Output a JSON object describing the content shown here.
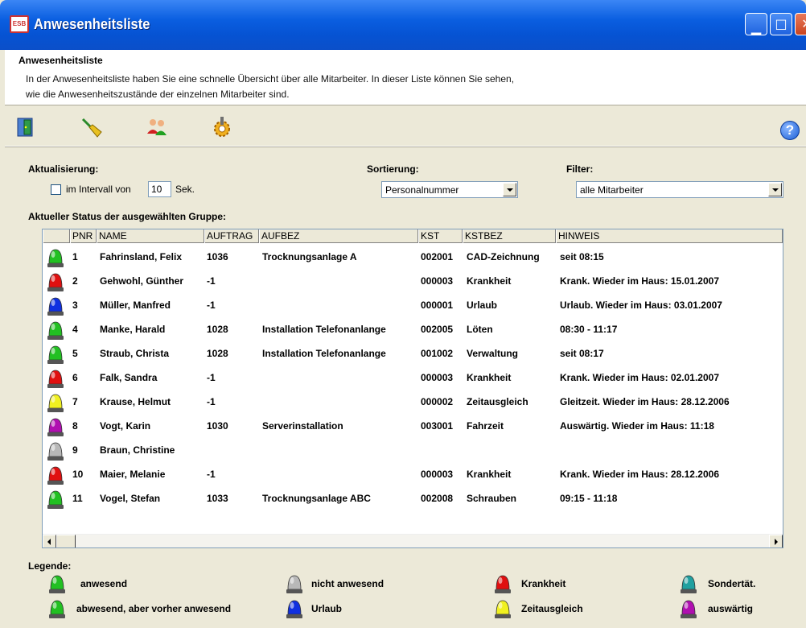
{
  "window": {
    "title": "Anwesenheitsliste",
    "app_icon_text": "ESB"
  },
  "header": {
    "title": "Anwesenheitsliste",
    "desc_line1": "In der Anwesenheitsliste haben Sie eine schnelle Übersicht über alle Mitarbeiter. In dieser Liste können Sie sehen,",
    "desc_line2": "wie die Anwesenheitszustände der einzelnen Mitarbeiter sind."
  },
  "toolbar": {
    "icons": [
      "exit-door-icon",
      "broom-icon",
      "users-icon",
      "settings-gear-icon"
    ],
    "help_label": "?"
  },
  "controls": {
    "aktualisierung_label": "Aktualisierung:",
    "interval_checkbox_label": "im Intervall von",
    "interval_value": "10",
    "interval_unit": "Sek.",
    "sortierung_label": "Sortierung:",
    "sortierung_value": "Personalnummer",
    "filter_label": "Filter:",
    "filter_value": "alle Mitarbeiter"
  },
  "grid": {
    "caption": "Aktueller Status der ausgewählten Gruppe:",
    "columns": [
      "",
      "PNR",
      "NAME",
      "AUFTRAG",
      "AUFBEZ",
      "KST",
      "KSTBEZ",
      "HINWEIS"
    ],
    "rows": [
      {
        "status": "anwesend",
        "pnr": "1",
        "name": "Fahrinsland, Felix",
        "auftrag": "1036",
        "aufbez": "Trocknungsanlage A",
        "kst": "002001",
        "kstbez": "CAD-Zeichnung",
        "hinweis": "seit 08:15"
      },
      {
        "status": "krankheit",
        "pnr": "2",
        "name": "Gehwohl, Günther",
        "auftrag": "-1",
        "aufbez": "",
        "kst": "000003",
        "kstbez": "Krankheit",
        "hinweis": "Krank. Wieder im Haus: 15.01.2007"
      },
      {
        "status": "urlaub",
        "pnr": "3",
        "name": "Müller, Manfred",
        "auftrag": "-1",
        "aufbez": "",
        "kst": "000001",
        "kstbez": "Urlaub",
        "hinweis": "Urlaub. Wieder im Haus: 03.01.2007"
      },
      {
        "status": "abwesend_vorher",
        "pnr": "4",
        "name": "Manke, Harald",
        "auftrag": "1028",
        "aufbez": "Installation Telefonanlange",
        "kst": "002005",
        "kstbez": "Löten",
        "hinweis": "08:30 - 11:17"
      },
      {
        "status": "anwesend",
        "pnr": "5",
        "name": "Straub, Christa",
        "auftrag": "1028",
        "aufbez": "Installation Telefonanlange",
        "kst": "001002",
        "kstbez": "Verwaltung",
        "hinweis": "seit 08:17"
      },
      {
        "status": "krankheit",
        "pnr": "6",
        "name": "Falk, Sandra",
        "auftrag": "-1",
        "aufbez": "",
        "kst": "000003",
        "kstbez": "Krankheit",
        "hinweis": "Krank. Wieder im Haus: 02.01.2007"
      },
      {
        "status": "zeitausgleich",
        "pnr": "7",
        "name": "Krause, Helmut",
        "auftrag": "-1",
        "aufbez": "",
        "kst": "000002",
        "kstbez": "Zeitausgleich",
        "hinweis": "Gleitzeit. Wieder im Haus: 28.12.2006"
      },
      {
        "status": "auswaertig",
        "pnr": "8",
        "name": "Vogt, Karin",
        "auftrag": "1030",
        "aufbez": "Serverinstallation",
        "kst": "003001",
        "kstbez": "Fahrzeit",
        "hinweis": "Auswärtig. Wieder im Haus: 11:18"
      },
      {
        "status": "nicht_anwesend",
        "pnr": "9",
        "name": "Braun, Christine",
        "auftrag": "",
        "aufbez": "",
        "kst": "",
        "kstbez": "",
        "hinweis": ""
      },
      {
        "status": "krankheit",
        "pnr": "10",
        "name": "Maier, Melanie",
        "auftrag": "-1",
        "aufbez": "",
        "kst": "000003",
        "kstbez": "Krankheit",
        "hinweis": "Krank. Wieder im Haus: 28.12.2006"
      },
      {
        "status": "abwesend_vorher",
        "pnr": "11",
        "name": "Vogel, Stefan",
        "auftrag": "1033",
        "aufbez": "Trocknungsanlage ABC",
        "kst": "002008",
        "kstbez": "Schrauben",
        "hinweis": "09:15 - 11:18"
      }
    ]
  },
  "legend": {
    "title": "Legende:",
    "items": [
      {
        "key": "anwesend",
        "label": "anwesend"
      },
      {
        "key": "nicht_anwesend",
        "label": "nicht anwesend"
      },
      {
        "key": "krankheit",
        "label": "Krankheit"
      },
      {
        "key": "sondertaet",
        "label": "Sondertät."
      },
      {
        "key": "abwesend_vorher",
        "label": "abwesend, aber vorher anwesend"
      },
      {
        "key": "urlaub",
        "label": "Urlaub"
      },
      {
        "key": "zeitausgleich",
        "label": "Zeitausgleich"
      },
      {
        "key": "auswaertig",
        "label": "auswärtig"
      }
    ]
  },
  "colors": {
    "anwesend": "#22c022",
    "abwesend_vorher": "#22c022",
    "krankheit": "#e01010",
    "urlaub": "#1030e0",
    "zeitausgleich": "#f0f020",
    "auswaertig": "#b010b0",
    "nicht_anwesend": "#b8b8b8",
    "sondertaet": "#20a0a0"
  }
}
